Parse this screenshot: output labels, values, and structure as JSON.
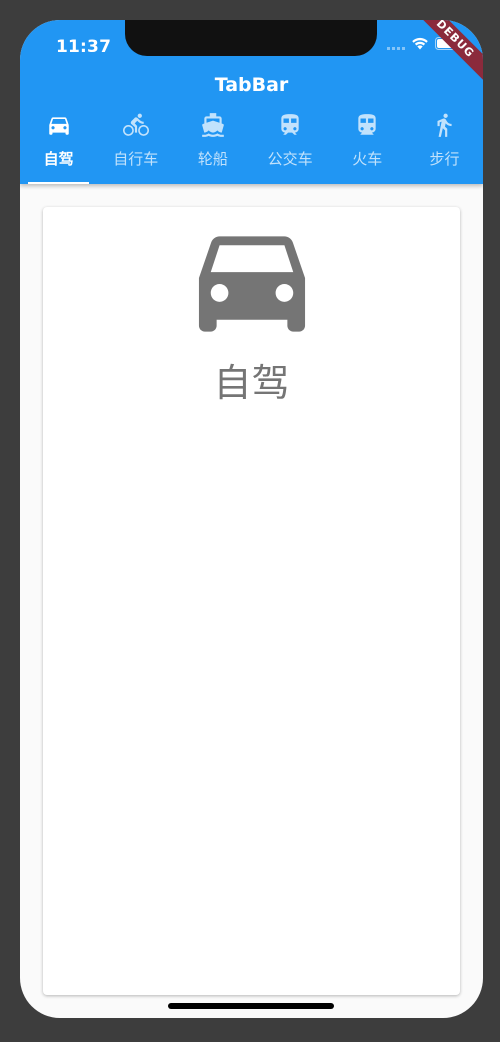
{
  "status_bar": {
    "time": "11:37"
  },
  "debug_banner": "DEBUG",
  "app_bar": {
    "title": "TabBar",
    "background_color": "#2196f3"
  },
  "tabs": [
    {
      "label": "自驾",
      "icon": "car-icon",
      "active": true
    },
    {
      "label": "自行车",
      "icon": "bicycle-icon",
      "active": false
    },
    {
      "label": "轮船",
      "icon": "boat-icon",
      "active": false
    },
    {
      "label": "公交车",
      "icon": "bus-icon",
      "active": false
    },
    {
      "label": "火车",
      "icon": "train-icon",
      "active": false
    },
    {
      "label": "步行",
      "icon": "walk-icon",
      "active": false
    }
  ],
  "content": {
    "icon": "car-icon",
    "label": "自驾",
    "icon_color": "#757575"
  }
}
